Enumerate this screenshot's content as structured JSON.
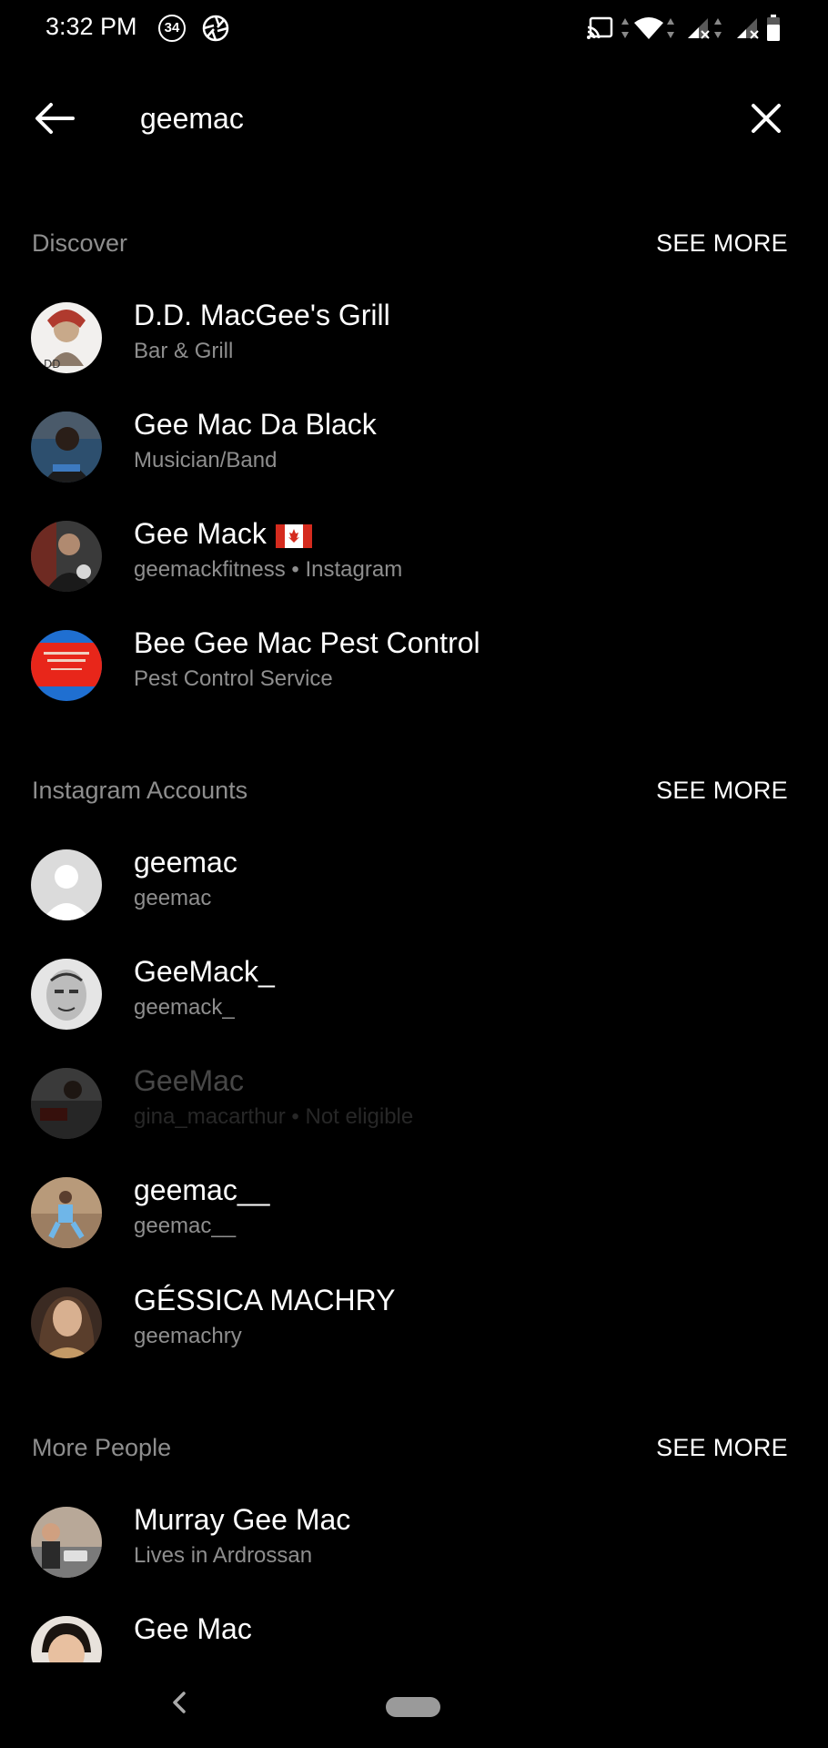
{
  "status_bar": {
    "time": "3:32 PM",
    "notification_count": "34"
  },
  "search": {
    "query": "geemac"
  },
  "sections": {
    "discover": {
      "title": "Discover",
      "see_more": "SEE MORE",
      "items": [
        {
          "name": "D.D. MacGee's Grill",
          "sub": "Bar & Grill"
        },
        {
          "name": "Gee Mac Da Black",
          "sub": "Musician/Band"
        },
        {
          "name": "Gee Mack",
          "sub": "geemackfitness • Instagram",
          "flag": "canada-flag-icon"
        },
        {
          "name": "Bee Gee Mac Pest Control",
          "sub": "Pest Control Service"
        }
      ]
    },
    "instagram": {
      "title": "Instagram Accounts",
      "see_more": "SEE MORE",
      "items": [
        {
          "name": "geemac",
          "sub": "geemac"
        },
        {
          "name": "GeeMack_",
          "sub": "geemack_"
        },
        {
          "name": "GeeMac",
          "sub": "gina_macarthur • Not eligible",
          "disabled": true
        },
        {
          "name": "geemac__",
          "sub": "geemac__"
        },
        {
          "name": "GÉSSICA MACHRY",
          "sub": "geemachry"
        }
      ]
    },
    "people": {
      "title": "More People",
      "see_more": "SEE MORE",
      "items": [
        {
          "name": "Murray Gee Mac",
          "sub": "Lives in Ardrossan"
        },
        {
          "name": "Gee Mac",
          "sub": ""
        }
      ]
    }
  },
  "colors": {
    "background": "#000000",
    "secondary_text": "#8e8e8e",
    "primary_text": "#ffffff"
  }
}
